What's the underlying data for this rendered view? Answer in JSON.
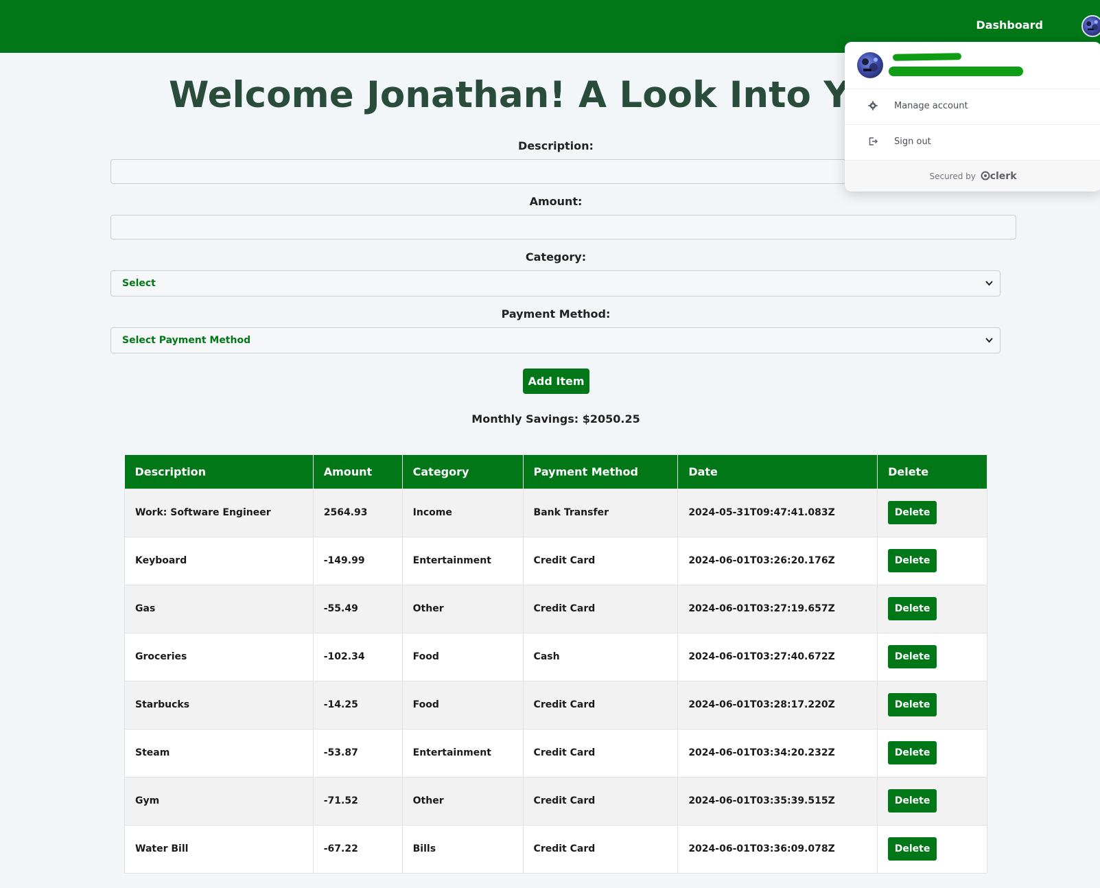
{
  "header": {
    "dashboard_label": "Dashboard"
  },
  "page": {
    "title": "Welcome Jonathan! A Look Into Your Fin"
  },
  "form": {
    "description_label": "Description:",
    "amount_label": "Amount:",
    "category_label": "Category:",
    "category_value": "Select",
    "payment_label": "Payment Method:",
    "payment_value": "Select Payment Method",
    "add_button_label": "Add Item"
  },
  "summary": {
    "savings_text": "Monthly Savings: $2050.25"
  },
  "table": {
    "headers": [
      "Description",
      "Amount",
      "Category",
      "Payment Method",
      "Date",
      "Delete"
    ],
    "rows": [
      {
        "description": "Work: Software Engineer",
        "amount": "2564.93",
        "category": "Income",
        "payment": "Bank Transfer",
        "date": "2024-05-31T09:47:41.083Z",
        "action": "Delete"
      },
      {
        "description": "Keyboard",
        "amount": "-149.99",
        "category": "Entertainment",
        "payment": "Credit Card",
        "date": "2024-06-01T03:26:20.176Z",
        "action": "Delete"
      },
      {
        "description": "Gas",
        "amount": "-55.49",
        "category": "Other",
        "payment": "Credit Card",
        "date": "2024-06-01T03:27:19.657Z",
        "action": "Delete"
      },
      {
        "description": "Groceries",
        "amount": "-102.34",
        "category": "Food",
        "payment": "Cash",
        "date": "2024-06-01T03:27:40.672Z",
        "action": "Delete"
      },
      {
        "description": "Starbucks",
        "amount": "-14.25",
        "category": "Food",
        "payment": "Credit Card",
        "date": "2024-06-01T03:28:17.220Z",
        "action": "Delete"
      },
      {
        "description": "Steam",
        "amount": "-53.87",
        "category": "Entertainment",
        "payment": "Credit Card",
        "date": "2024-06-01T03:34:20.232Z",
        "action": "Delete"
      },
      {
        "description": "Gym",
        "amount": "-71.52",
        "category": "Other",
        "payment": "Credit Card",
        "date": "2024-06-01T03:35:39.515Z",
        "action": "Delete"
      },
      {
        "description": "Water Bill",
        "amount": "-67.22",
        "category": "Bills",
        "payment": "Credit Card",
        "date": "2024-06-01T03:36:09.078Z",
        "action": "Delete"
      }
    ]
  },
  "user_menu": {
    "manage_account_label": "Manage account",
    "sign_out_label": "Sign out",
    "secured_by_label": "Secured by",
    "clerk_brand": "clerk"
  },
  "colors": {
    "brand_green": "#017718",
    "title_color": "#2a4d3b",
    "page_bg": "#f3f6f8"
  },
  "icons": {
    "settings": "gear-icon",
    "sign_out": "sign-out-icon",
    "select": "chevron-down-icon"
  }
}
